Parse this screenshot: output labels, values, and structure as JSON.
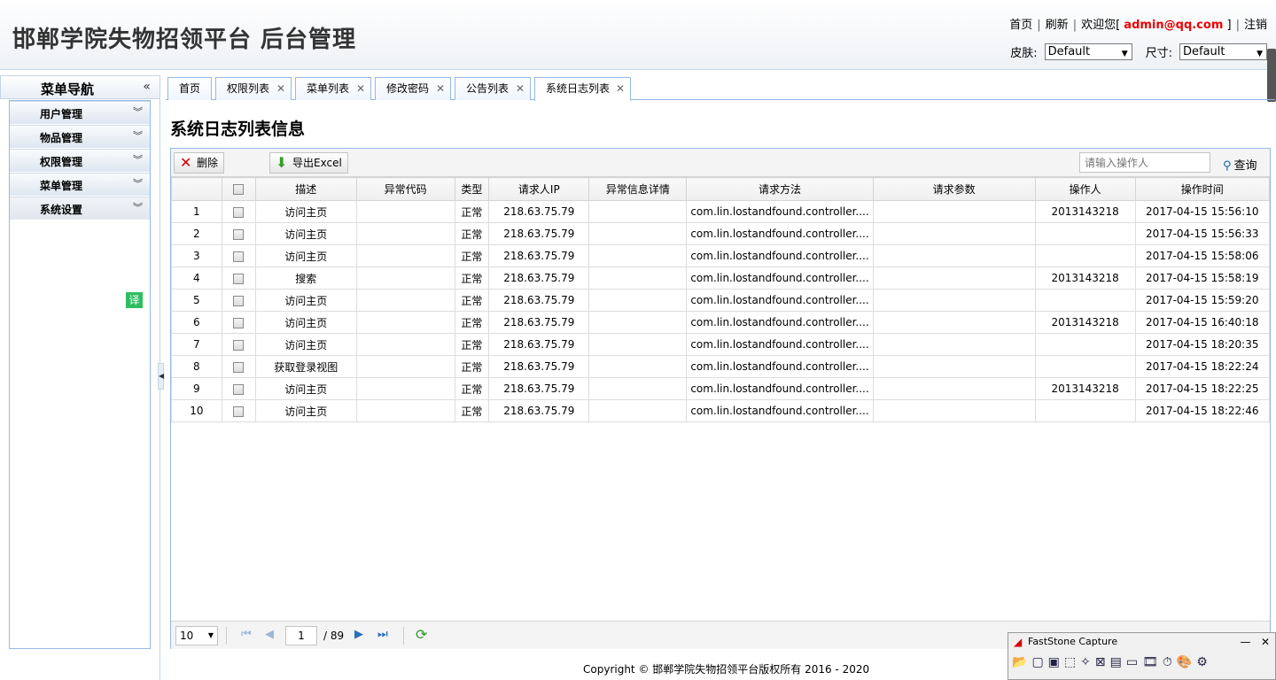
{
  "header": {
    "title": "邯郸学院失物招领平台 后台管理",
    "links": {
      "home": "首页",
      "refresh": "刷新",
      "welcome_prefix": "欢迎您[",
      "user": "admin@qq.com",
      "welcome_suffix": "]",
      "logout": "注销"
    },
    "skin_label": "皮肤:",
    "skin_value": "Default",
    "size_label": "尺寸:",
    "size_value": "Default"
  },
  "sidebar": {
    "title": "菜单导航",
    "collapse_icon": "«",
    "items": [
      {
        "label": "用户管理"
      },
      {
        "label": "物品管理"
      },
      {
        "label": "权限管理"
      },
      {
        "label": "菜单管理"
      },
      {
        "label": "系统设置"
      }
    ],
    "translate_badge": "译"
  },
  "tabs": [
    {
      "label": "首页"
    },
    {
      "label": "权限列表"
    },
    {
      "label": "菜单列表"
    },
    {
      "label": "修改密码"
    },
    {
      "label": "公告列表"
    },
    {
      "label": "系统日志列表"
    }
  ],
  "page_heading": "系统日志列表信息",
  "toolbar": {
    "delete_label": "删除",
    "export_label": "导出Excel",
    "search_placeholder": "请输入操作人",
    "search_label": "查询"
  },
  "table": {
    "columns": [
      "描述",
      "异常代码",
      "类型",
      "请求人IP",
      "异常信息详情",
      "请求方法",
      "请求参数",
      "操作人",
      "操作时间"
    ],
    "rows": [
      [
        "1",
        "访问主页",
        "",
        "正常",
        "218.63.75.79",
        "",
        "com.lin.lostandfound.controller....",
        "",
        "2013143218",
        "2017-04-15 15:56:10"
      ],
      [
        "2",
        "访问主页",
        "",
        "正常",
        "218.63.75.79",
        "",
        "com.lin.lostandfound.controller....",
        "",
        "",
        "2017-04-15 15:56:33"
      ],
      [
        "3",
        "访问主页",
        "",
        "正常",
        "218.63.75.79",
        "",
        "com.lin.lostandfound.controller....",
        "",
        "",
        "2017-04-15 15:58:06"
      ],
      [
        "4",
        "搜索",
        "",
        "正常",
        "218.63.75.79",
        "",
        "com.lin.lostandfound.controller....",
        "",
        "2013143218",
        "2017-04-15 15:58:19"
      ],
      [
        "5",
        "访问主页",
        "",
        "正常",
        "218.63.75.79",
        "",
        "com.lin.lostandfound.controller....",
        "",
        "",
        "2017-04-15 15:59:20"
      ],
      [
        "6",
        "访问主页",
        "",
        "正常",
        "218.63.75.79",
        "",
        "com.lin.lostandfound.controller....",
        "",
        "2013143218",
        "2017-04-15 16:40:18"
      ],
      [
        "7",
        "访问主页",
        "",
        "正常",
        "218.63.75.79",
        "",
        "com.lin.lostandfound.controller....",
        "",
        "",
        "2017-04-15 18:20:35"
      ],
      [
        "8",
        "获取登录视图",
        "",
        "正常",
        "218.63.75.79",
        "",
        "com.lin.lostandfound.controller....",
        "",
        "",
        "2017-04-15 18:22:24"
      ],
      [
        "9",
        "访问主页",
        "",
        "正常",
        "218.63.75.79",
        "",
        "com.lin.lostandfound.controller....",
        "",
        "2013143218",
        "2017-04-15 18:22:25"
      ],
      [
        "10",
        "访问主页",
        "",
        "正常",
        "218.63.75.79",
        "",
        "com.lin.lostandfound.controller....",
        "",
        "",
        "2017-04-15 18:22:46"
      ]
    ]
  },
  "pager": {
    "page_size": "10",
    "current_page": "1",
    "total_pages": "/ 89"
  },
  "footer": "Copyright © 邯郸学院失物招领平台版权所有  2016 - 2020",
  "faststone": {
    "title": "FastStone Capture"
  }
}
